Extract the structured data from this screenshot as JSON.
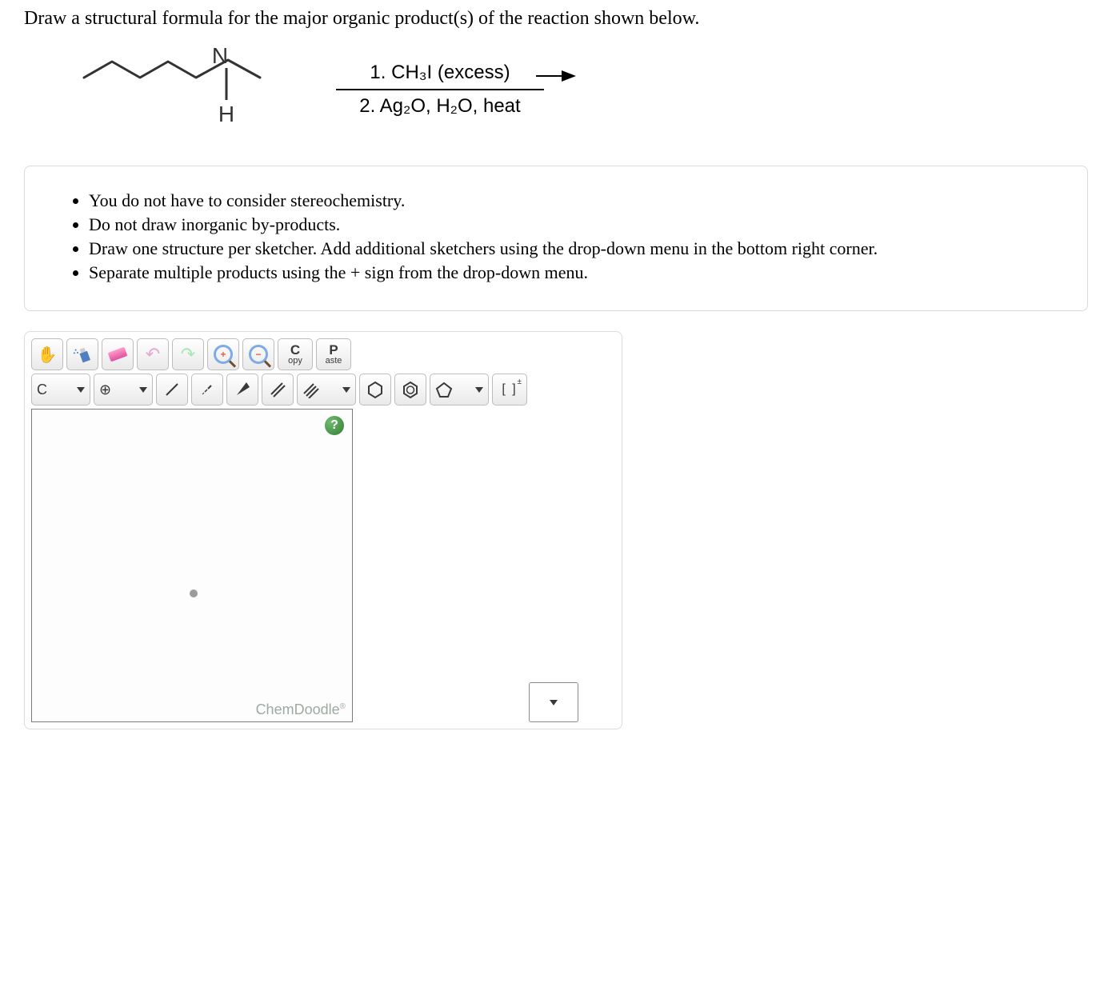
{
  "question": "Draw a structural formula for the major organic product(s) of the reaction shown below.",
  "reaction": {
    "reactant_label_N": "N",
    "reactant_label_H": "H",
    "condition_1": "1. CH₃I  (excess)",
    "condition_2": "2. Ag₂O, H₂O, heat"
  },
  "instructions": [
    "You do not have to consider stereochemistry.",
    "Do not draw inorganic by-products.",
    "Draw one structure per sketcher. Add additional sketchers using the drop-down menu in the bottom right corner.",
    "Separate multiple products using the + sign from the drop-down menu."
  ],
  "toolbar": {
    "copy_big": "C",
    "copy_small": "opy",
    "paste_big": "P",
    "paste_small": "aste",
    "element_label": "C",
    "charge_label": "⊕",
    "bracket_label": "[ ]",
    "bracket_pm": "±"
  },
  "canvas": {
    "help": "?",
    "branding": "ChemDoodle",
    "branding_r": "®"
  }
}
